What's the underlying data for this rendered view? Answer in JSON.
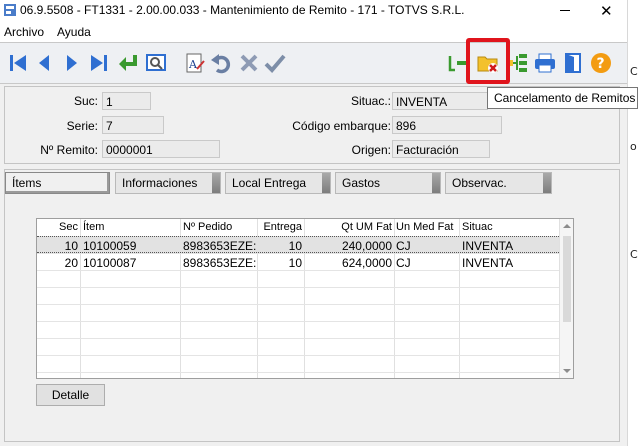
{
  "window": {
    "title": "06.9.5508 - FT1331 - 2.00.00.033 - Mantenimiento de Remito - 171 - TOTVS S.R.L."
  },
  "menu": {
    "items": [
      "Archivo",
      "Ayuda"
    ]
  },
  "toolbar": {
    "tooltip": "Cancelamento de Remitos",
    "colors": {
      "highlight": "#e0141c",
      "nav_blue": "#2f6fd1",
      "confirm_green": "#3a9a2f"
    }
  },
  "header": {
    "suc": {
      "label": "Suc:",
      "value": "1"
    },
    "serie": {
      "label": "Serie:",
      "value": "7"
    },
    "remito": {
      "label": "Nº Remito:",
      "value": "0000001"
    },
    "situac": {
      "label": "Situac.:",
      "value": "INVENTA"
    },
    "codigo": {
      "label": "Código embarque:",
      "value": "896"
    },
    "origen": {
      "label": "Origen:",
      "value": "Facturación"
    }
  },
  "tabs": [
    "Ítems",
    "Informaciones",
    "Local Entrega",
    "Gastos",
    "Observac."
  ],
  "grid": {
    "columns": [
      "Sec",
      "Ítem",
      "Nº Pedido",
      "Entrega",
      "Qt UM Fat",
      "Un Med Fat",
      "Situac"
    ],
    "rows": [
      {
        "sec": "10",
        "item": "10100059",
        "pedido": "8983653EZE:",
        "entrega": "10",
        "qt": "240,0000",
        "um": "CJ",
        "situac": "INVENTA"
      },
      {
        "sec": "20",
        "item": "10100087",
        "pedido": "8983653EZE:",
        "entrega": "10",
        "qt": "624,0000",
        "um": "CJ",
        "situac": "INVENTA"
      }
    ]
  },
  "buttons": {
    "detalle": "Detalle"
  },
  "side_letters": [
    "C",
    "o",
    "C"
  ]
}
